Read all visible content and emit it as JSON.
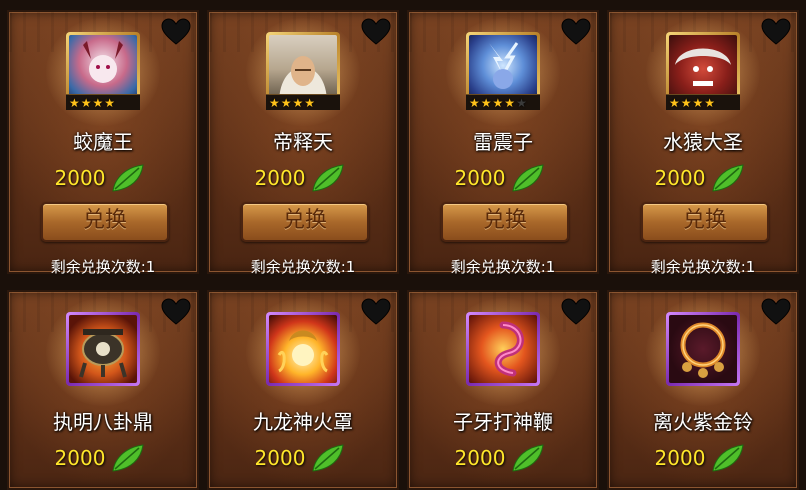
{
  "shop": {
    "heroes": [
      {
        "name": "蛟魔王",
        "price": "2000",
        "button": "兑换",
        "remaining": "剩余兑换次数:1",
        "stars": 4,
        "max_stars": 4,
        "icon": "hero-portrait-jiaomowang-icon"
      },
      {
        "name": "帝释天",
        "price": "2000",
        "button": "兑换",
        "remaining": "剩余兑换次数:1",
        "stars": 4,
        "max_stars": 4,
        "icon": "hero-portrait-dishitian-icon"
      },
      {
        "name": "雷震子",
        "price": "2000",
        "button": "兑换",
        "remaining": "剩余兑换次数:1",
        "stars": 4,
        "max_stars": 5,
        "icon": "hero-portrait-leizhenzi-icon"
      },
      {
        "name": "水猿大圣",
        "price": "2000",
        "button": "兑换",
        "remaining": "剩余兑换次数:1",
        "stars": 4,
        "max_stars": 4,
        "icon": "hero-portrait-shuiyuandasheng-icon"
      }
    ],
    "items": [
      {
        "name": "执明八卦鼎",
        "price": "2000",
        "icon": "bagua-cauldron-icon"
      },
      {
        "name": "九龙神火罩",
        "price": "2000",
        "icon": "dragon-fire-cover-icon"
      },
      {
        "name": "子牙打神鞭",
        "price": "2000",
        "icon": "god-whip-icon"
      },
      {
        "name": "离火紫金铃",
        "price": "2000",
        "icon": "purple-gold-bell-icon"
      }
    ],
    "currency_icon": "green-leaf-icon",
    "favorite_icon": "heart-icon",
    "colors": {
      "price": "#ffe72a",
      "star": "#ffc21a",
      "card": "#6a3a1d",
      "rare_frame": "#b9822a",
      "epic_frame": "#7a2ab0"
    }
  }
}
